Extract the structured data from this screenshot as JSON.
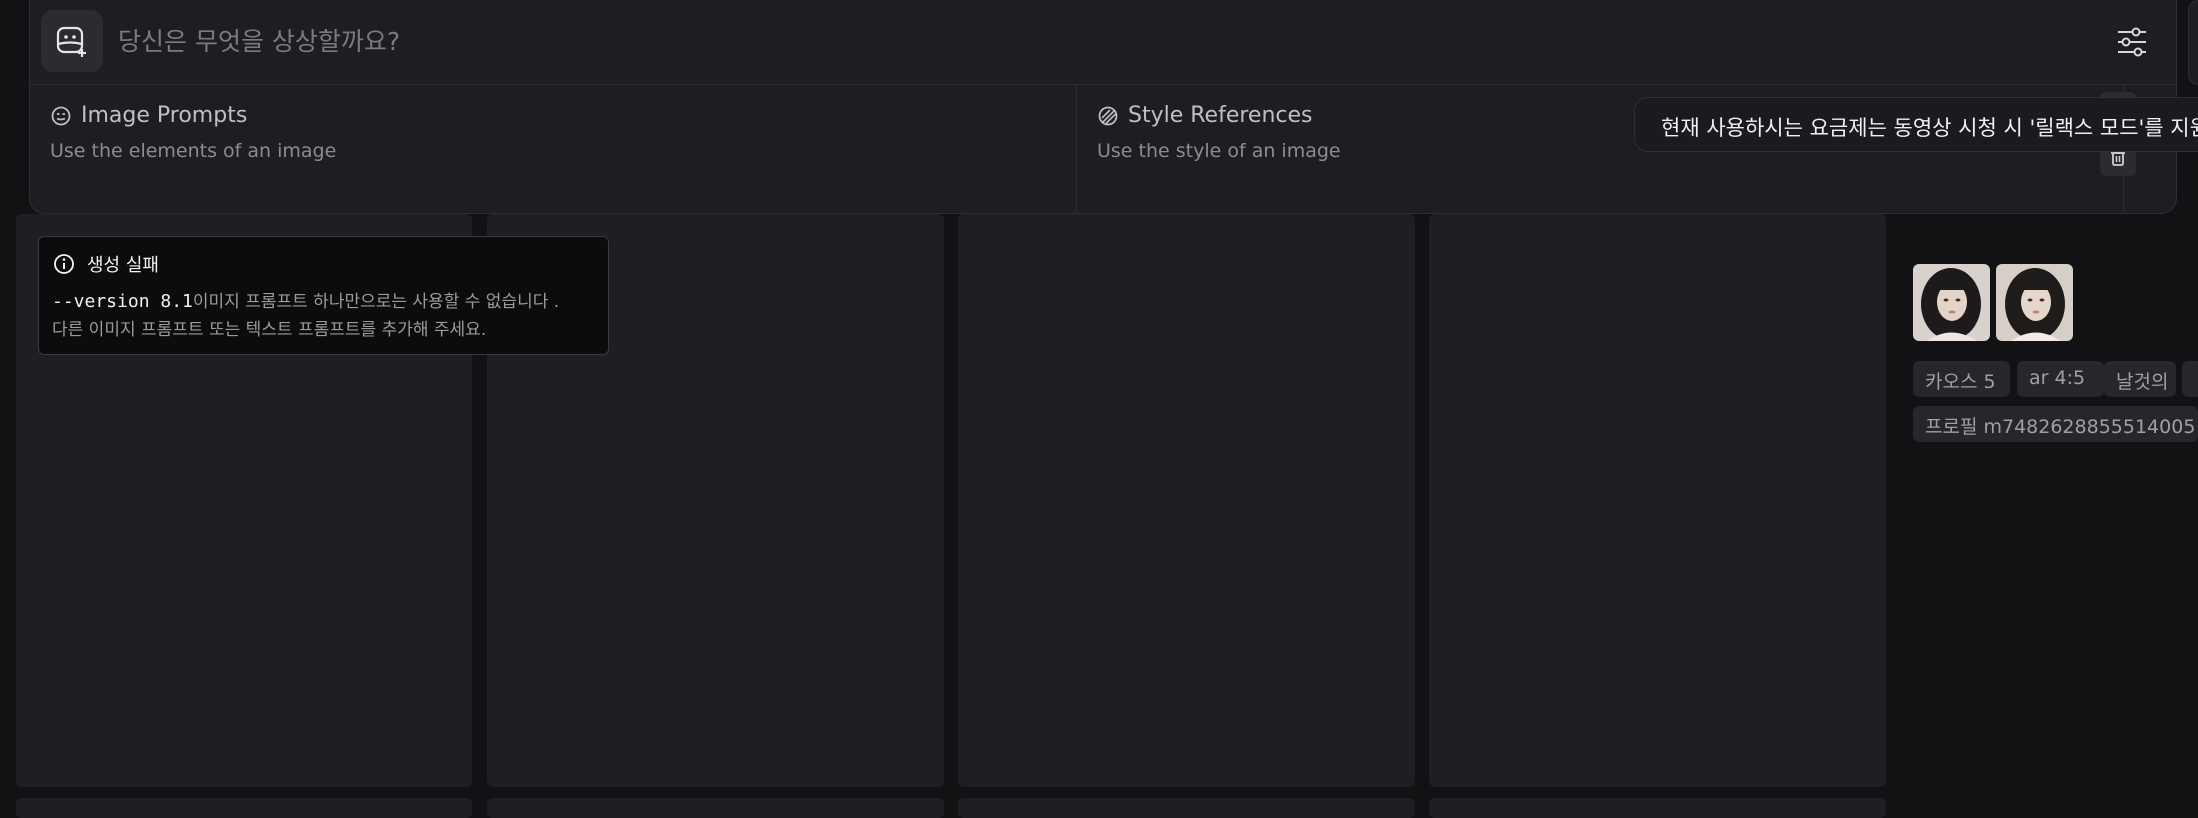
{
  "prompt": {
    "placeholder": "당신은 무엇을 상상할까요?",
    "add_image_icon": "image-add-icon",
    "settings_icon": "sliders-icon"
  },
  "image_prompts": {
    "title": "Image Prompts",
    "description": "Use the elements of an image",
    "icon": "smile-circle-icon"
  },
  "style_references": {
    "title": "Style References",
    "description": "Use the style of an image",
    "icon": "hatched-circle-icon"
  },
  "tooltip": {
    "text": "현재 사용하시는 요금제는 동영상 시청 시 '릴랙스 모드'를 지원"
  },
  "error": {
    "title": "생성 실패",
    "code": "--version 8.1",
    "message_part1": "이미지 프롬프트 하나만으로는 사용할 수 없습니다 .",
    "message_part2": "다른 이미지 프롬프트 또는 텍스트 프롬프트를 추가해 주세요."
  },
  "job_info": {
    "tags": [
      "카오스 5",
      "ar 4:5",
      "날것의"
    ],
    "profile": "프로필 m7482628855514005"
  },
  "colors": {
    "background": "#121214",
    "card": "#1e1f23",
    "panel": "#1d1e22"
  }
}
